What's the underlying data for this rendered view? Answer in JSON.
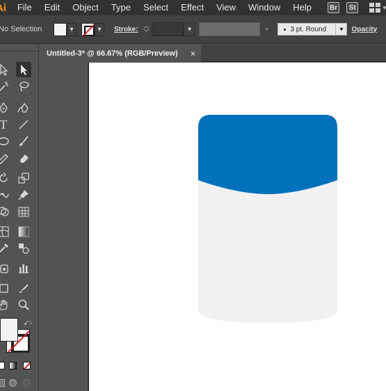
{
  "app": {
    "logo_text": "Ai",
    "menu": [
      "File",
      "Edit",
      "Object",
      "Type",
      "Select",
      "Effect",
      "View",
      "Window",
      "Help"
    ],
    "bridge_buttons": [
      "Br",
      "St"
    ]
  },
  "control_bar": {
    "selection_status": "No Selection",
    "stroke_label": "Stroke:",
    "brush_label": "3 pt. Round",
    "opacity_label": "Opacity"
  },
  "document_tab": {
    "title": "Untitled-3* @ 66.67% (RGB/Preview)",
    "close_glyph": "×"
  },
  "tools": [
    "selection-tool",
    "direct-selection-tool",
    "magic-wand-tool",
    "lasso-tool",
    "pen-tool",
    "curvature-tool",
    "type-tool",
    "line-segment-tool",
    "ellipse-tool",
    "paintbrush-tool",
    "shaper-tool",
    "eraser-tool",
    "rotate-tool",
    "scale-tool",
    "puppet-warp-tool",
    "pin-tool",
    "shape-builder-tool",
    "perspective-grid-tool",
    "mesh-tool",
    "gradient-tool",
    "eyedropper-tool",
    "blend-tool",
    "symbol-sprayer-tool",
    "column-graph-tool",
    "artboard-tool",
    "slice-tool",
    "hand-tool",
    "zoom-tool"
  ],
  "artwork": {
    "lid_color": "#0072bc",
    "body_color": "#f1f1f1"
  },
  "colors": {
    "menubar": "#323232",
    "controlbar": "#424242",
    "panel": "#535353",
    "stroke_none_slash": "#e01b1b"
  }
}
